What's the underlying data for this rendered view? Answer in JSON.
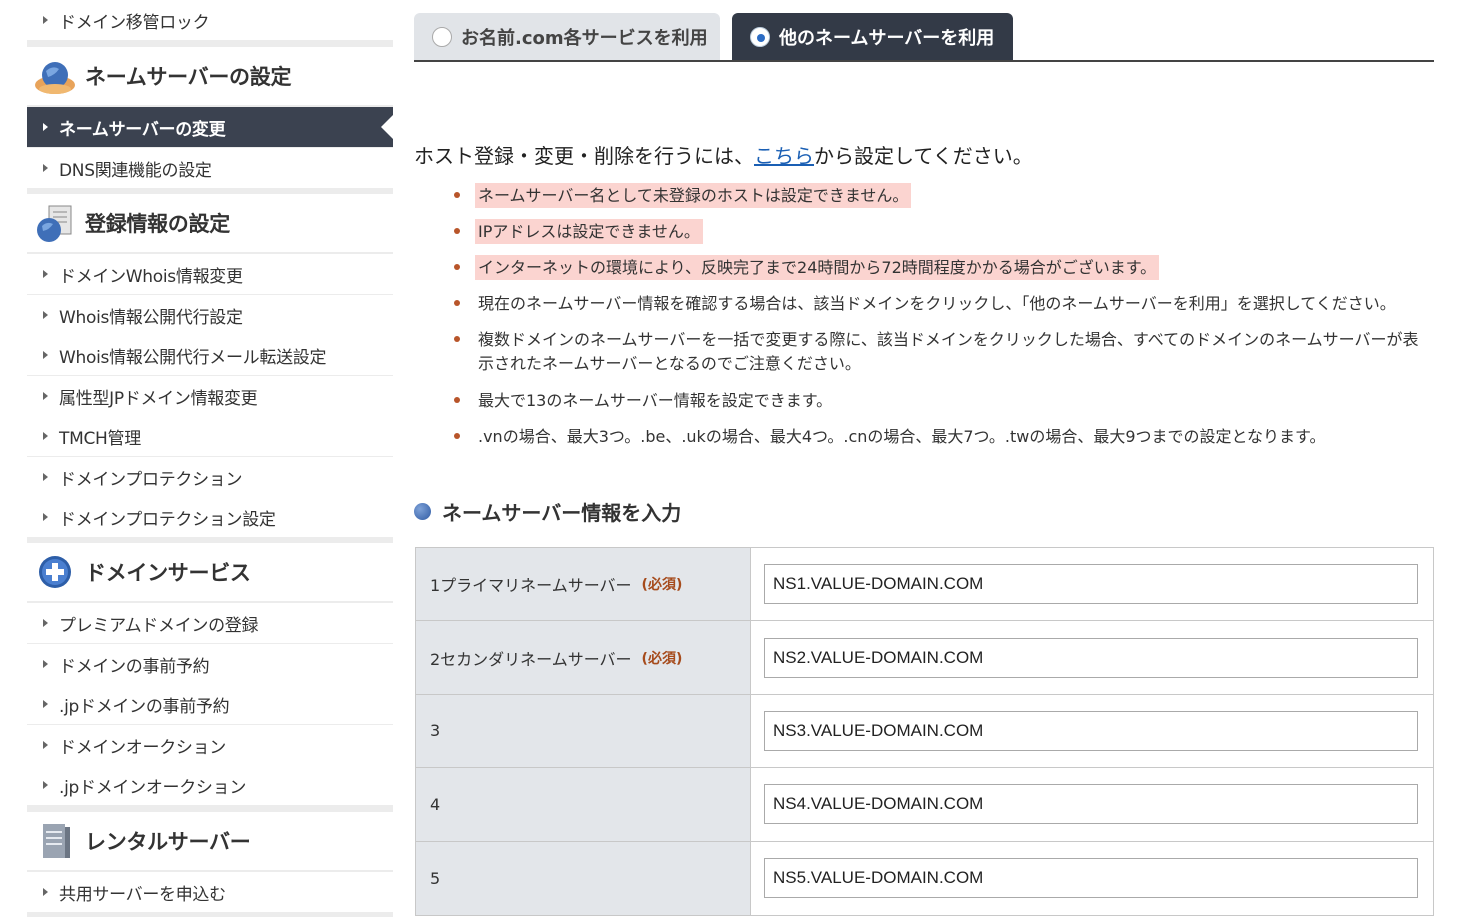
{
  "sidebar": {
    "items": [
      {
        "label": "ドメイン移管ロック"
      },
      {
        "label": "ネームサーバーの変更"
      },
      {
        "label": "DNS関連機能の設定"
      },
      {
        "label": "ドメインWhois情報変更"
      },
      {
        "label": "Whois情報公開代行設定"
      },
      {
        "label": "Whois情報公開代行メール転送設定"
      },
      {
        "label": "属性型JPドメイン情報変更"
      },
      {
        "label": "TMCH管理"
      },
      {
        "label": "ドメインプロテクション"
      },
      {
        "label": "ドメインプロテクション設定"
      },
      {
        "label": "プレミアムドメインの登録"
      },
      {
        "label": "ドメインの事前予約"
      },
      {
        "label": ".jpドメインの事前予約"
      },
      {
        "label": "ドメインオークション"
      },
      {
        "label": ".jpドメインオークション"
      },
      {
        "label": "共用サーバーを申込む"
      }
    ],
    "sections": [
      {
        "title": "ネームサーバーの設定",
        "icon": "globe-hands-icon"
      },
      {
        "title": "登録情報の設定",
        "icon": "globe-document-icon"
      },
      {
        "title": "ドメインサービス",
        "icon": "plus-circle-icon"
      },
      {
        "title": "レンタルサーバー",
        "icon": "server-icon"
      }
    ]
  },
  "tabs": {
    "onamae": "お名前.com各サービスを利用",
    "other": "他のネームサーバーを利用"
  },
  "intro": {
    "before": "ホスト登録・変更・削除を行うには、",
    "link": "こちら",
    "after": "から設定してください。"
  },
  "notes": [
    "ネームサーバー名として未登録のホストは設定できません。",
    "IPアドレスは設定できません。",
    "インターネットの環境により、反映完了まで24時間から72時間程度かかる場合がございます。",
    "現在のネームサーバー情報を確認する場合は、該当ドメインをクリックし、「他のネームサーバーを利用」を選択してください。",
    "複数ドメインのネームサーバーを一括で変更する際に、該当ドメインをクリックした場合、すべてのドメインのネームサーバーが表",
    "示されたネームサーバーとなるのでご注意ください。",
    "最大で13のネームサーバー情報を設定できます。",
    ".vnの場合、最大3つ。.be、.ukの場合、最大4つ。.cnの場合、最大7つ。.twの場合、最大9つまでの設定となります。"
  ],
  "section_title": "ネームサーバー情報を入力",
  "required_label": "(必須)",
  "ns_rows": [
    {
      "label": "1プライマリネームサーバー",
      "value": "NS1.VALUE-DOMAIN.COM"
    },
    {
      "label": "2セカンダリネームサーバー",
      "value": "NS2.VALUE-DOMAIN.COM"
    },
    {
      "label": "3",
      "value": "NS3.VALUE-DOMAIN.COM"
    },
    {
      "label": "4",
      "value": "NS4.VALUE-DOMAIN.COM"
    },
    {
      "label": "5",
      "value": "NS5.VALUE-DOMAIN.COM"
    }
  ],
  "colors": {
    "accent": "#2c6cc4",
    "active_nav": "#3b4250",
    "highlight": "#fbd4d0",
    "required": "#a64b1c"
  }
}
